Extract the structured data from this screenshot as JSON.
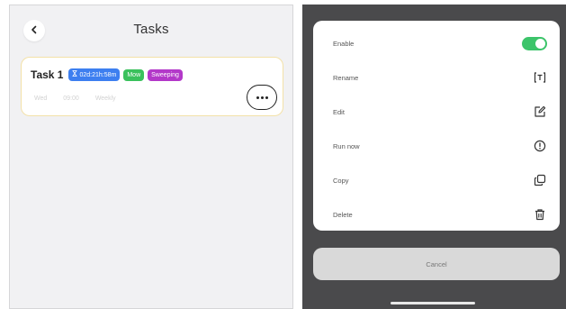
{
  "left_screen": {
    "header": {
      "title": "Tasks"
    },
    "task": {
      "name": "Task 1",
      "badges": [
        {
          "label": "02d:21h:58m",
          "icon": "hourglass-icon",
          "color": "#3d7ff0"
        },
        {
          "label": "Mow",
          "color": "#3ac15c"
        },
        {
          "label": "Sweeping",
          "color": "#b338c9"
        }
      ],
      "details": [
        "Wed",
        "09:00",
        "Weekly"
      ]
    }
  },
  "right_screen": {
    "action_sheet": {
      "items": [
        {
          "label": "Enable",
          "control": "toggle",
          "enabled": true
        },
        {
          "label": "Rename",
          "icon": "rename-icon"
        },
        {
          "label": "Edit",
          "icon": "edit-icon"
        },
        {
          "label": "Run now",
          "icon": "run-now-icon"
        },
        {
          "label": "Copy",
          "icon": "copy-icon"
        },
        {
          "label": "Delete",
          "icon": "delete-icon"
        }
      ]
    },
    "cancel_label": "Cancel"
  },
  "colors": {
    "accent_green": "#3cc46a",
    "badge_blue": "#3d7ff0",
    "badge_green": "#3ac15c",
    "badge_purple": "#b338c9",
    "sheet_backdrop": "#4a4a4c"
  }
}
